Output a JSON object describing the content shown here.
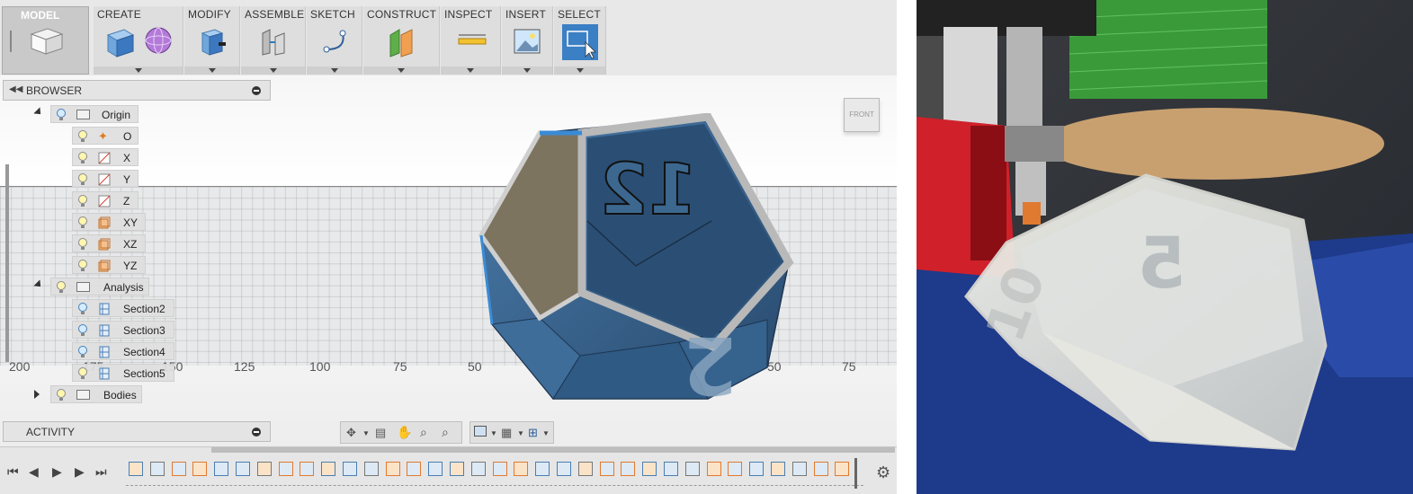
{
  "toolbar": {
    "model_label": "MODEL",
    "groups": [
      {
        "label": "CREATE"
      },
      {
        "label": "MODIFY"
      },
      {
        "label": "ASSEMBLE"
      },
      {
        "label": "SKETCH"
      },
      {
        "label": "CONSTRUCT"
      },
      {
        "label": "INSPECT"
      },
      {
        "label": "INSERT"
      },
      {
        "label": "SELECT"
      }
    ]
  },
  "viewcube": {
    "face": "FRONT"
  },
  "browser": {
    "title": "BROWSER",
    "items": [
      {
        "label": "Origin",
        "icon": "folder-icon"
      },
      {
        "label": "O",
        "icon": "origin-point-icon"
      },
      {
        "label": "X",
        "icon": "axis-icon"
      },
      {
        "label": "Y",
        "icon": "axis-icon"
      },
      {
        "label": "Z",
        "icon": "axis-icon"
      },
      {
        "label": "XY",
        "icon": "plane-icon"
      },
      {
        "label": "XZ",
        "icon": "plane-icon"
      },
      {
        "label": "YZ",
        "icon": "plane-icon"
      },
      {
        "label": "Analysis",
        "icon": "folder-icon"
      },
      {
        "label": "Section2",
        "icon": "section-icon"
      },
      {
        "label": "Section3",
        "icon": "section-icon"
      },
      {
        "label": "Section4",
        "icon": "section-icon"
      },
      {
        "label": "Section5",
        "icon": "section-icon"
      },
      {
        "label": "Bodies",
        "icon": "folder-icon"
      }
    ]
  },
  "activity": {
    "title": "ACTIVITY"
  },
  "ruler": {
    "labels": [
      "200",
      "175",
      "150",
      "125",
      "100",
      "75",
      "50",
      "25",
      "0",
      "25",
      "50",
      "75"
    ]
  },
  "model": {
    "engraved_numbers": [
      "12",
      "2"
    ]
  },
  "photo": {
    "printed_numbers": [
      "5",
      "10"
    ]
  },
  "colors": {
    "accent": "#2f79b9",
    "model_body": "#2e5b84",
    "panel": "#e4e4e4"
  }
}
